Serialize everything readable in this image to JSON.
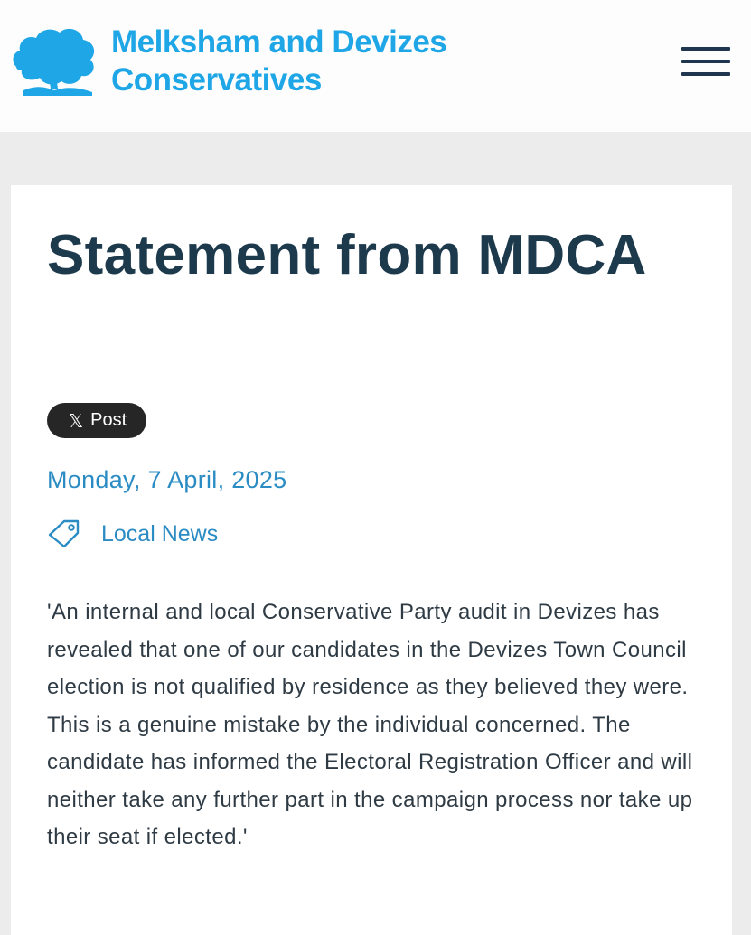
{
  "header": {
    "logo_icon": "oak-tree-logo-icon",
    "brand_line1": "Melksham and Devizes",
    "brand_line2": "Conservatives",
    "brand_color": "#1ea6e6",
    "menu_icon": "hamburger-menu-icon"
  },
  "article": {
    "title": "Statement from MDCA",
    "share_button_icon": "x-logo-icon",
    "share_button_glyph": "𝕏",
    "share_button_label": "Post",
    "date": "Monday, 7 April, 2025",
    "category_icon": "tag-icon",
    "category": "Local News",
    "body": "'An internal and local Conservative Party audit in Devizes has revealed that one of our candidates in the Devizes Town Council election is not qualified by residence as they believed they were. This is a genuine mistake by the individual concerned. The candidate has informed the Electoral Registration Officer and will neither take any further part in the campaign process nor take up their seat if elected.'"
  },
  "colors": {
    "title": "#1d3a4d",
    "link": "#2b8cc4",
    "body_text": "#2f3b44",
    "page_background": "#ececec",
    "share_button_bg": "#262626"
  }
}
